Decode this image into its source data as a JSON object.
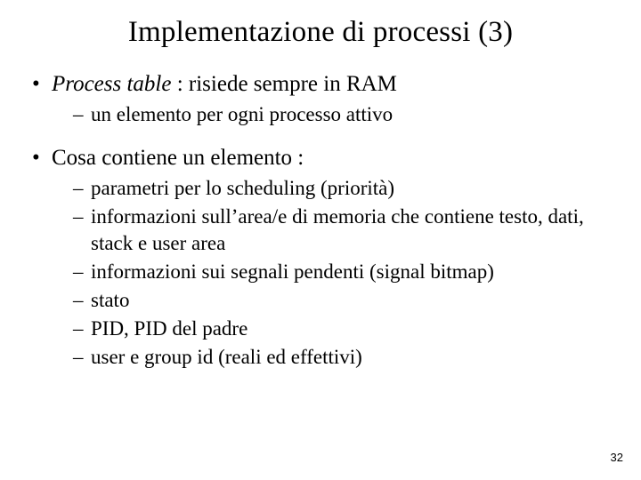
{
  "title": "Implementazione di processi (3)",
  "bullets": [
    {
      "emph": "Process table",
      "rest": " : risiede sempre in RAM",
      "sub": [
        "un elemento per ogni processo attivo"
      ]
    },
    {
      "plain": "Cosa contiene un elemento :",
      "sub": [
        "parametri per lo scheduling (priorità)",
        "informazioni sull’area/e di memoria che contiene testo, dati, stack e user area",
        "informazioni sui segnali pendenti (signal bitmap)",
        "stato",
        "PID, PID del padre",
        "user e group id (reali ed effettivi)"
      ]
    }
  ],
  "page_number": "32"
}
